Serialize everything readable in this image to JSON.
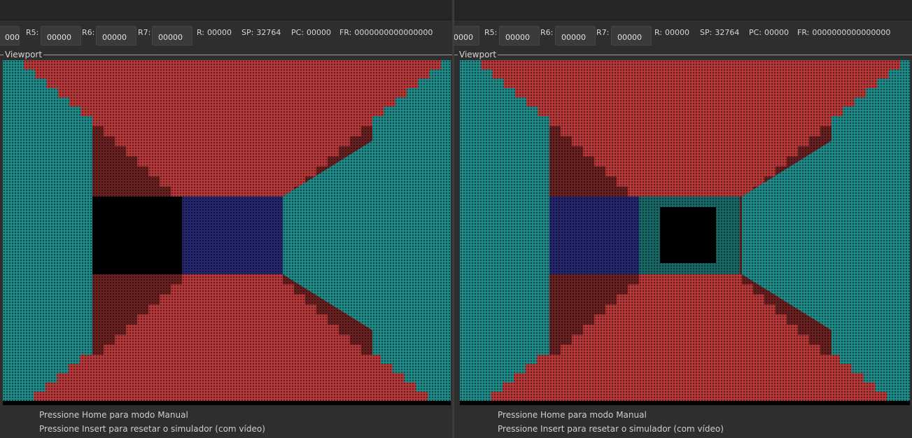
{
  "panels": [
    {
      "registers": [
        {
          "label": "",
          "value": "000"
        },
        {
          "label": "R5:",
          "value": "00000"
        },
        {
          "label": "R6:",
          "value": "00000"
        },
        {
          "label": "R7:",
          "value": "00000"
        }
      ],
      "stats": [
        {
          "label": "R:",
          "value": "00000"
        },
        {
          "label": "SP:",
          "value": "32764"
        },
        {
          "label": "PC:",
          "value": "00000"
        },
        {
          "label": "FR:",
          "value": "0000000000000000"
        }
      ],
      "viewport_label": "Viewport",
      "status_lines": [
        "Pressione Home para modo Manual",
        "Pressione Insert para resetar o simulador (com vídeo)"
      ]
    },
    {
      "registers": [
        {
          "label": "",
          "value": "0000"
        },
        {
          "label": "R5:",
          "value": "00000"
        },
        {
          "label": "R6:",
          "value": "00000"
        },
        {
          "label": "R7:",
          "value": "00000"
        }
      ],
      "stats": [
        {
          "label": "R:",
          "value": "00000"
        },
        {
          "label": "SP:",
          "value": "32764"
        },
        {
          "label": "PC:",
          "value": "00000"
        },
        {
          "label": "FR:",
          "value": "0000000000000000"
        }
      ],
      "viewport_label": "Viewport",
      "status_lines": [
        "Pressione Home para modo Manual",
        "Pressione Insert para resetar o simulador (com vídeo)"
      ]
    }
  ],
  "colors": {
    "wall_red": "#b8393a",
    "wall_red_dark": "#6a2020",
    "wall_teal": "#1f8c8a",
    "wall_teal_dim": "#176a68",
    "wall_blue": "#24266e",
    "void": "#000000",
    "dot": "#000000"
  },
  "scenes": [
    {
      "view": "corridor-left-opening"
    },
    {
      "view": "corridor-deep"
    }
  ]
}
